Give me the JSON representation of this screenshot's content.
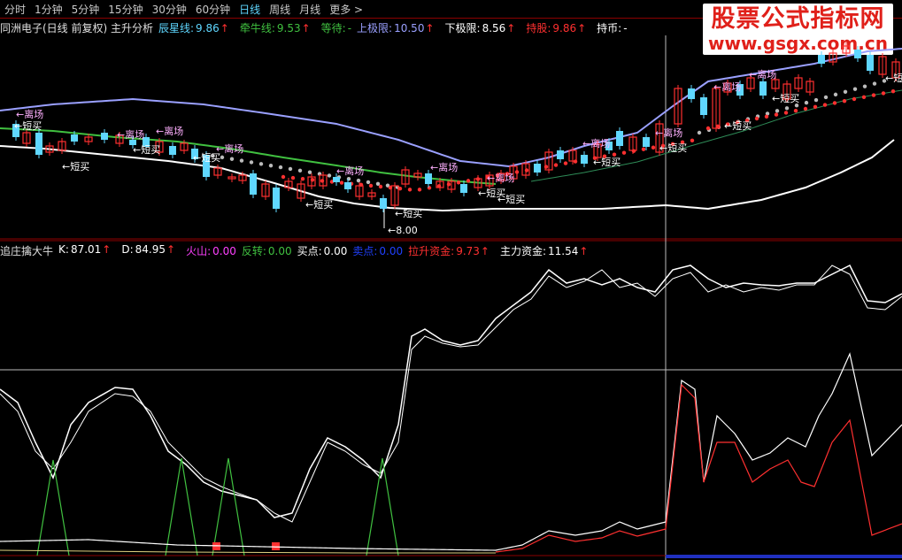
{
  "toolbar": {
    "items": [
      {
        "label": "分时"
      },
      {
        "label": "1分钟"
      },
      {
        "label": "5分钟"
      },
      {
        "label": "15分钟"
      },
      {
        "label": "30分钟"
      },
      {
        "label": "60分钟"
      },
      {
        "label": "日线"
      },
      {
        "label": "周线"
      },
      {
        "label": "月线"
      },
      {
        "label": "更多 >"
      }
    ],
    "active": "日线"
  },
  "watermark": {
    "line1": "股票公式指标网",
    "line2": "www.gsgx.com.cn"
  },
  "main_header": {
    "title": "同洲电子(日线 前复权) 主升分析",
    "items": [
      {
        "label": "辰星线:",
        "value": "9.86",
        "color": "#5fd7ff",
        "arrow": true
      },
      {
        "label": "牵牛线:",
        "value": "9.53",
        "color": "#40c040",
        "arrow": true
      },
      {
        "label": "等待:",
        "value": "-",
        "color": "#40c040",
        "arrow": false
      },
      {
        "label": "上极限:",
        "value": "10.50",
        "color": "#9aa0ff",
        "arrow": true
      },
      {
        "label": "下极限:",
        "value": "8.56",
        "color": "#ffffff",
        "arrow": true
      },
      {
        "label": "持股:",
        "value": "9.86",
        "color": "#ff3030",
        "arrow": true
      },
      {
        "label": "持币:",
        "value": "-",
        "color": "#ffffff",
        "arrow": false
      }
    ]
  },
  "sub_header": {
    "title": "追庄擒大牛",
    "items": [
      {
        "label": "K:",
        "value": "87.01",
        "color": "#ffffff",
        "arrow": true
      },
      {
        "label": "D:",
        "value": "84.95",
        "color": "#ffffff",
        "arrow": true
      },
      {
        "label": "火山:",
        "value": "0.00",
        "color": "#ff40ff",
        "arrow": false
      },
      {
        "label": "反转:",
        "value": "0.00",
        "color": "#40c040",
        "arrow": false
      },
      {
        "label": "买点:",
        "value": "0.00",
        "color": "#ffffff",
        "arrow": false
      },
      {
        "label": "卖点:",
        "value": "0.00",
        "color": "#2040ff",
        "arrow": false
      },
      {
        "label": "拉升资金:",
        "value": "9.73",
        "color": "#ff3030",
        "arrow": true
      },
      {
        "label": "主力资金:",
        "value": "11.54",
        "color": "#ffffff",
        "arrow": true
      }
    ]
  },
  "annotations": {
    "leave": "←离场",
    "short_buy": "←短买",
    "low_price": "8.00"
  },
  "colors": {
    "up": "#ff3030",
    "down": "#5fd7ff",
    "upper_band": "#9aa0ff",
    "lower_band": "#ffffff",
    "mid_green": "#40c040",
    "dark_green": "#2e8b57",
    "grid": "#8b0000"
  }
}
